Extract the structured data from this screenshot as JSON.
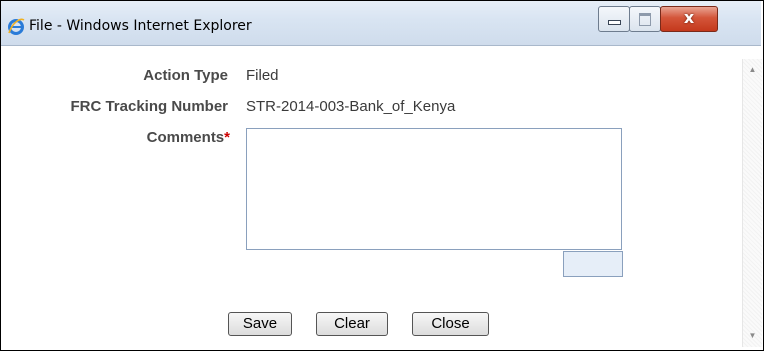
{
  "window": {
    "title": "File - Windows Internet Explorer",
    "close_glyph": "x",
    "icons": {
      "app": "ie-icon",
      "minimize": "minimize-icon",
      "maximize": "maximize-icon",
      "close": "close-icon"
    }
  },
  "form": {
    "action_type_label": "Action Type",
    "action_type_value": "Filed",
    "frc_label": "FRC Tracking Number",
    "frc_value": "STR-2014-003-Bank_of_Kenya",
    "comments_label": "Comments",
    "required_marker": "*",
    "comments_value": ""
  },
  "buttons": {
    "save": "Save",
    "clear": "Clear",
    "close": "Close"
  },
  "colors": {
    "required": "#cc0000",
    "close_button": "#c4391c",
    "titlebar": "#d8e4f2"
  }
}
